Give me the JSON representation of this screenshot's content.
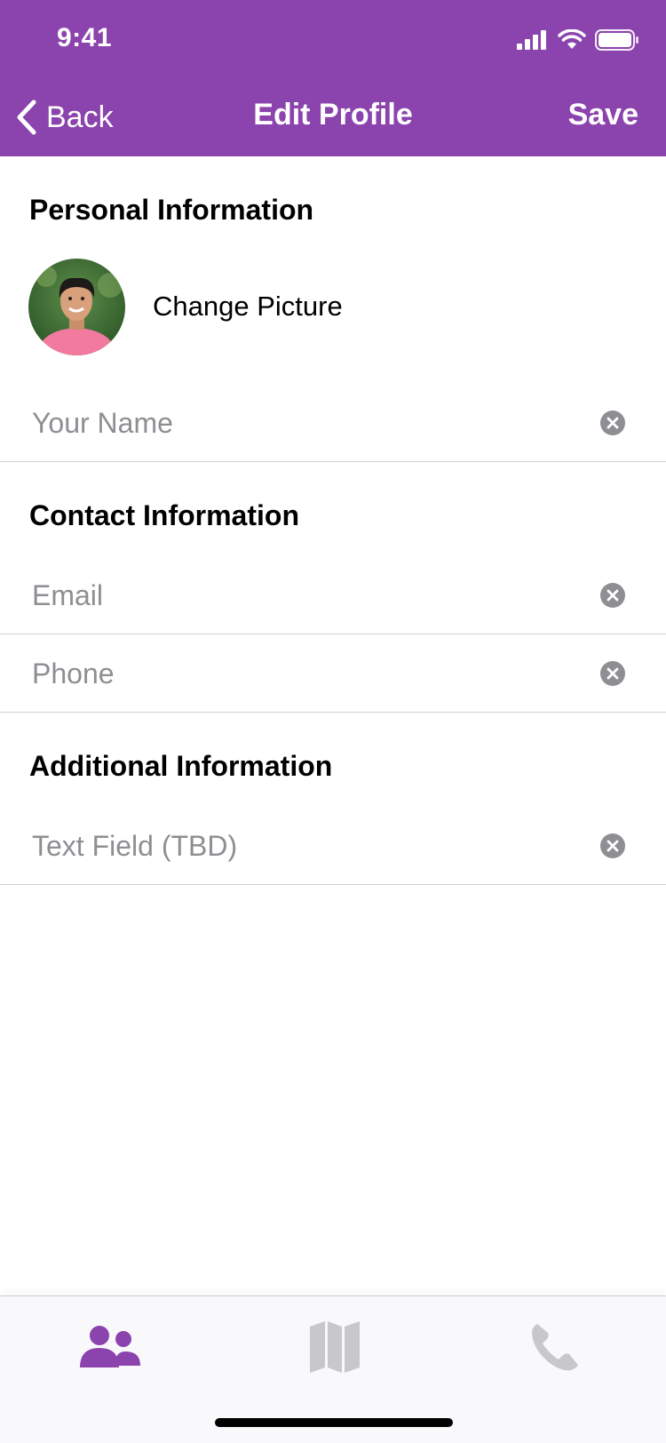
{
  "status_bar": {
    "time": "9:41"
  },
  "nav": {
    "back_label": "Back",
    "title": "Edit Profile",
    "save_label": "Save",
    "background": "#8b43ad"
  },
  "personal": {
    "title": "Personal Information",
    "change_picture": "Change Picture",
    "name_placeholder": "Your Name"
  },
  "contact": {
    "title": "Contact Information",
    "email_placeholder": "Email",
    "phone_placeholder": "Phone"
  },
  "additional": {
    "title": "Additional Information",
    "text_placeholder": "Text Field (TBD)"
  },
  "tabbar": {
    "active_color": "#8b43ad",
    "inactive_color": "#c7c7cc",
    "tabs": [
      {
        "icon": "people-icon",
        "active": true
      },
      {
        "icon": "map-icon",
        "active": false
      },
      {
        "icon": "phone-icon",
        "active": false
      }
    ]
  }
}
